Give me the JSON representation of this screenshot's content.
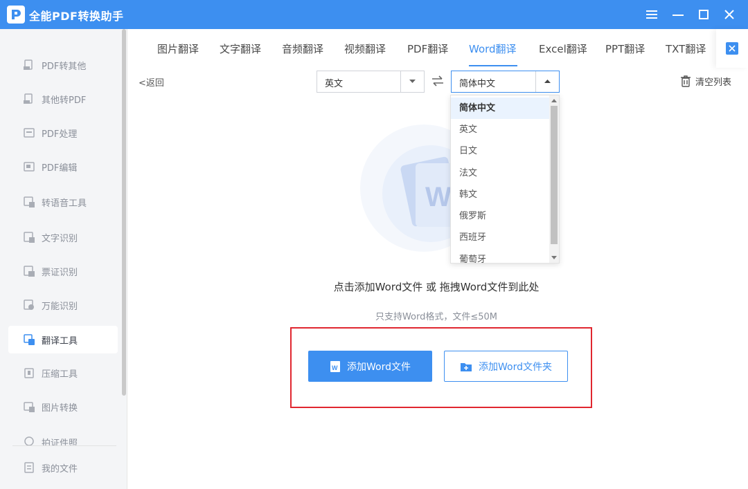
{
  "app": {
    "title": "全能PDF转换助手"
  },
  "sidebar": {
    "items": [
      {
        "label": "PDF转其他",
        "icon": "pdf-export-icon"
      },
      {
        "label": "其他转PDF",
        "icon": "pdf-import-icon"
      },
      {
        "label": "PDF处理",
        "icon": "pdf-process-icon"
      },
      {
        "label": "PDF编辑",
        "icon": "pdf-edit-icon"
      },
      {
        "label": "转语音工具",
        "icon": "text-to-speech-icon"
      },
      {
        "label": "文字识别",
        "icon": "ocr-icon"
      },
      {
        "label": "票证识别",
        "icon": "receipt-icon"
      },
      {
        "label": "万能识别",
        "icon": "universal-recognition-icon"
      },
      {
        "label": "翻译工具",
        "icon": "translate-icon",
        "active": true
      },
      {
        "label": "压缩工具",
        "icon": "compress-icon"
      },
      {
        "label": "图片转换",
        "icon": "image-convert-icon"
      },
      {
        "label": "拍证件照",
        "icon": "id-photo-icon"
      }
    ],
    "my_files": "我的文件"
  },
  "tabs": [
    "图片翻译",
    "文字翻译",
    "音频翻译",
    "视频翻译",
    "PDF翻译",
    "Word翻译",
    "Excel翻译",
    "PPT翻译",
    "TXT翻译"
  ],
  "active_tab": "Word翻译",
  "toolbar": {
    "back": "返回",
    "source_lang": "英文",
    "target_lang": "简体中文",
    "clear_list": "清空列表"
  },
  "dropdown": {
    "options": [
      "简体中文",
      "英文",
      "日文",
      "法文",
      "韩文",
      "俄罗斯",
      "西班牙",
      "葡萄牙"
    ],
    "selected": "简体中文"
  },
  "upload": {
    "prompt": "点击添加Word文件 或 拖拽Word文件到此处",
    "hint": "只支持Word格式，文件≤50M",
    "add_file": "添加Word文件",
    "add_folder": "添加Word文件夹"
  },
  "colors": {
    "accent": "#3d8ff0",
    "highlight": "#e0262f"
  }
}
